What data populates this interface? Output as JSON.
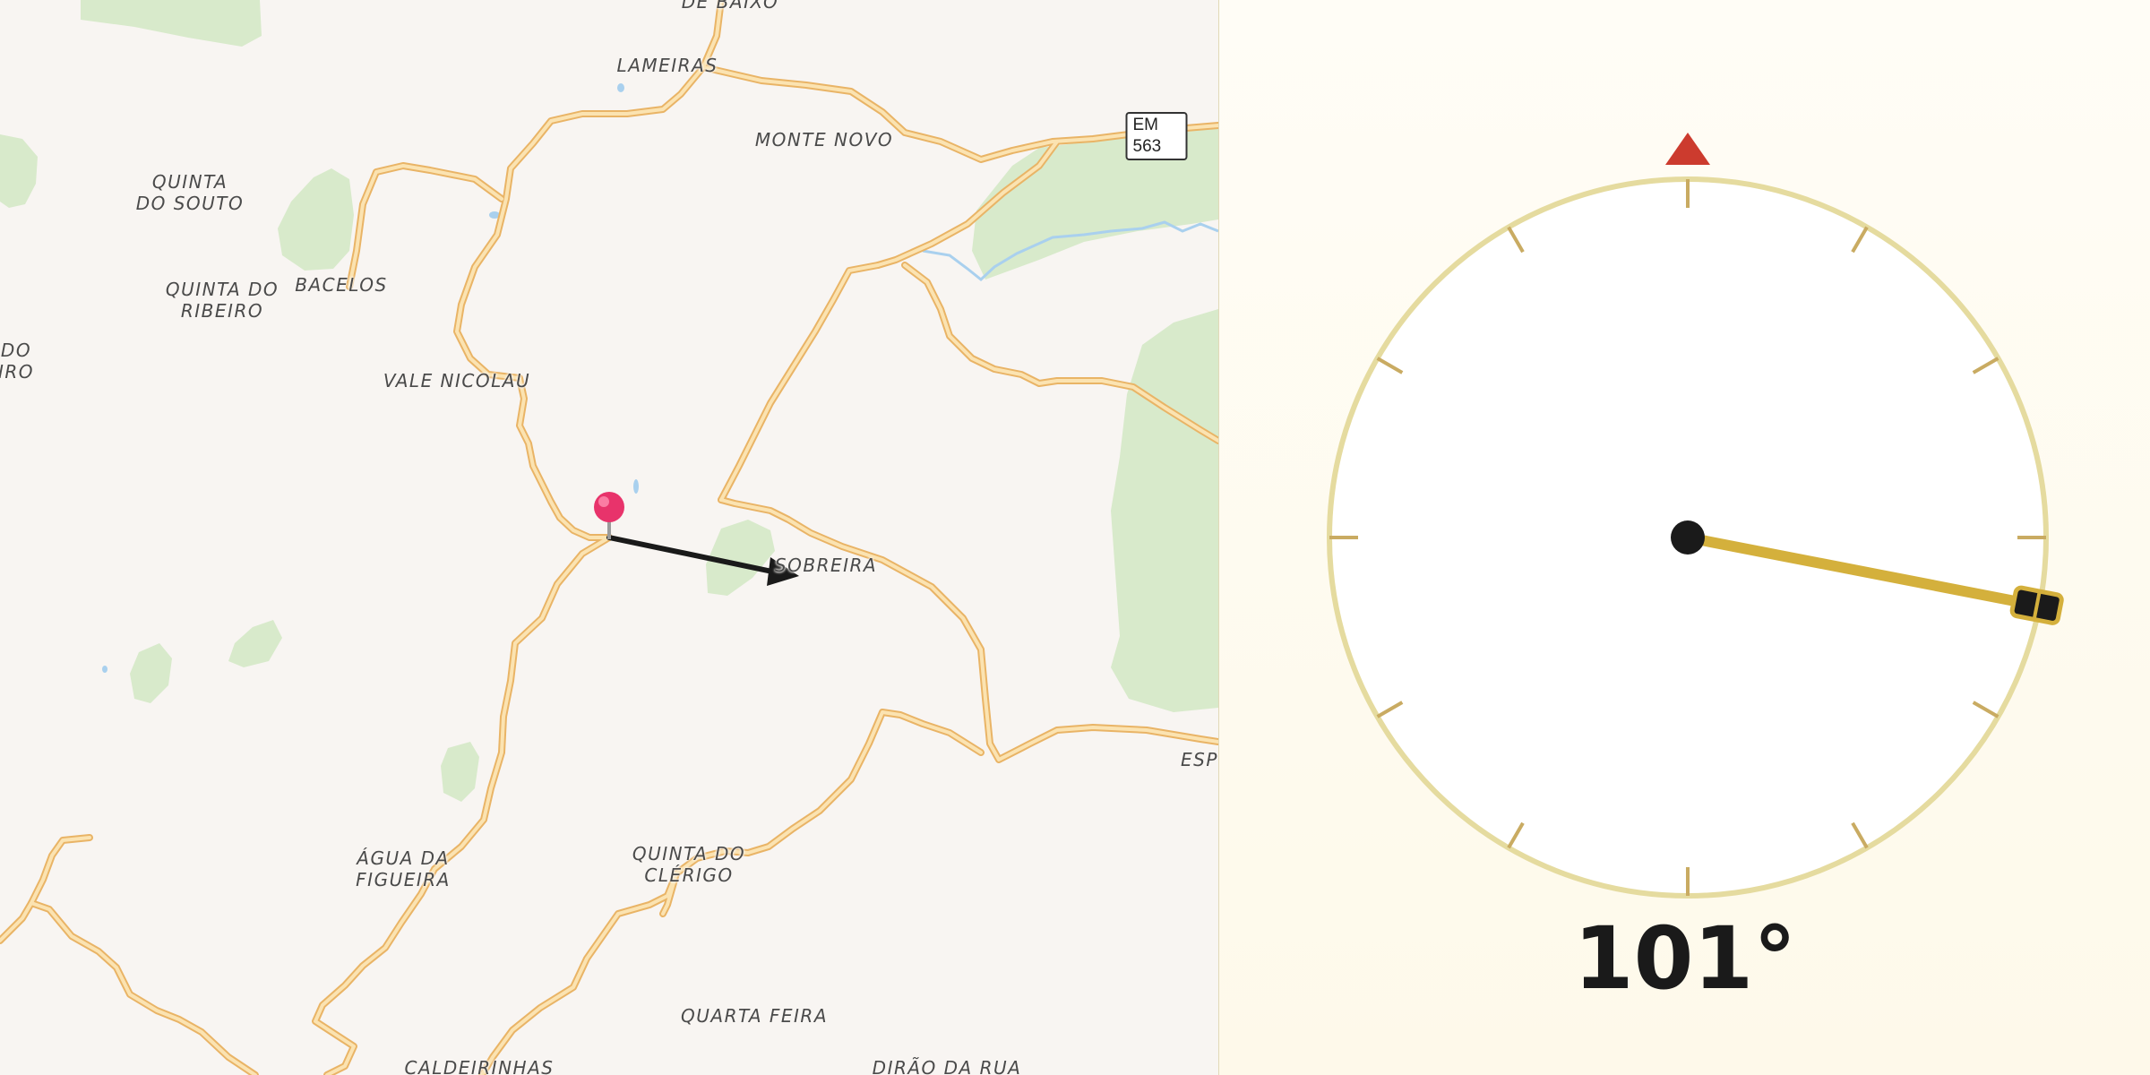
{
  "map": {
    "places": [
      {
        "id": "de-baixo",
        "text": "DE BAIXO"
      },
      {
        "id": "lameiras",
        "text": "LAMEIRAS"
      },
      {
        "id": "monte-novo",
        "text": "MONTE NOVO"
      },
      {
        "id": "quinta-do-souto",
        "text": "QUINTA\nDO SOUTO"
      },
      {
        "id": "bacelos",
        "text": "BACELOS"
      },
      {
        "id": "quinta-do-ribeiro",
        "text": "QUINTA DO\nRIBEIRO"
      },
      {
        "id": "do-iro",
        "text": "DO\nIRO"
      },
      {
        "id": "vale-nicolau",
        "text": "VALE NICOLAU"
      },
      {
        "id": "sobreira",
        "text": "SOBREIRA"
      },
      {
        "id": "esp",
        "text": "ESP"
      },
      {
        "id": "agua-da-figueira",
        "text": "ÁGUA DA\nFIGUEIRA"
      },
      {
        "id": "quinta-do-clerigo",
        "text": "QUINTA DO\nCLÉRIGO"
      },
      {
        "id": "quarta-feira",
        "text": "QUARTA FEIRA"
      },
      {
        "id": "caldeirinhas",
        "text": "CALDEIRINHAS"
      },
      {
        "id": "dirao-da-rua",
        "text": "DIRÃO DA RUA"
      }
    ],
    "road_shield": "EM 563",
    "colors": {
      "land": "#f8f5f2",
      "road": "#f7d38c",
      "road_casing": "#e9b466",
      "park": "#d8eacb",
      "water": "#a9d0ee",
      "pin": "#e8336b",
      "direction_arrow": "#1a1a1a"
    }
  },
  "compass": {
    "heading_deg": 101,
    "heading_text": "101°",
    "colors": {
      "north_marker": "#cc3b2e",
      "ring": "#e5db9f",
      "tick": "#c9ab62",
      "needle": "#d4b03c",
      "hub": "#1a1a1a"
    }
  }
}
